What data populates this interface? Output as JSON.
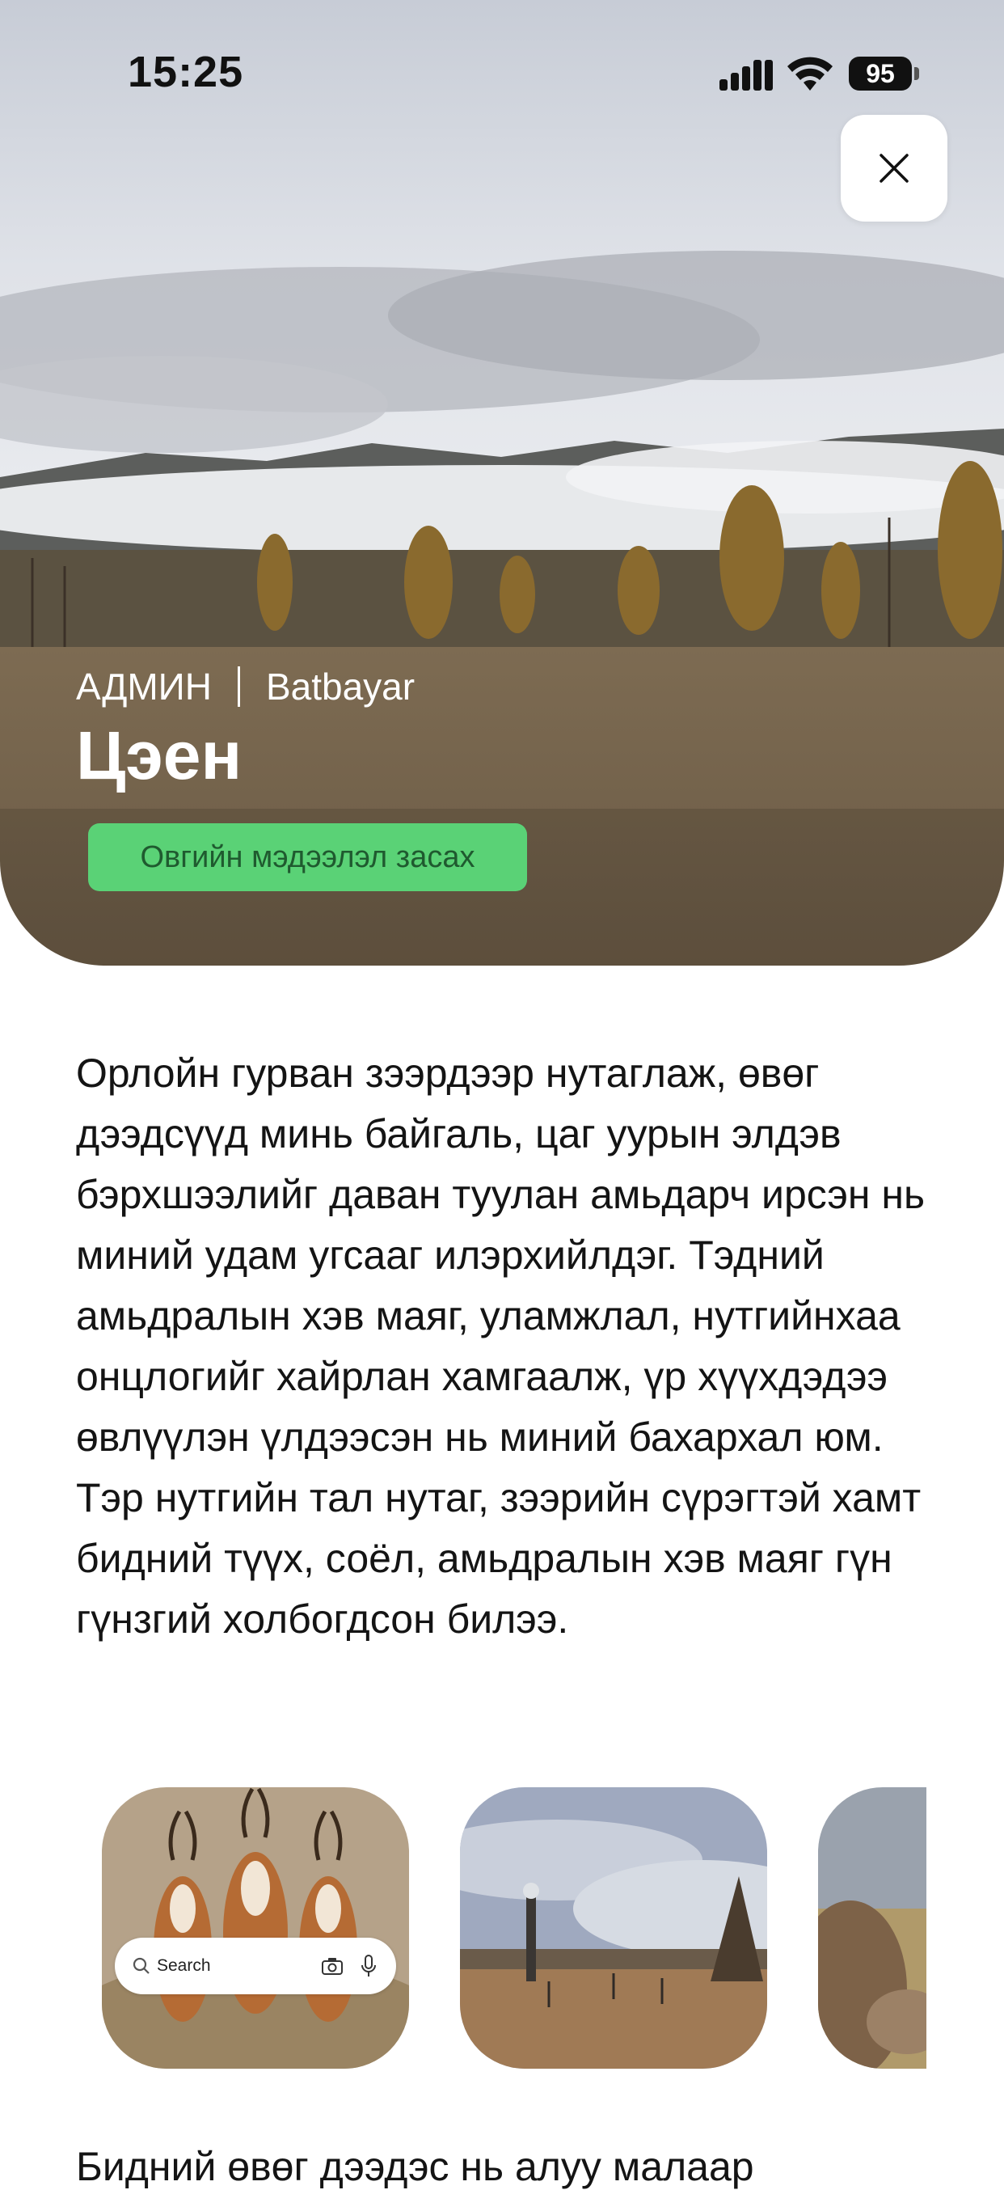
{
  "status_bar": {
    "time": "15:25",
    "battery": "95"
  },
  "hero": {
    "role": "АДМИН",
    "author": "Batbayar",
    "title": "Цэен",
    "edit_button_label": "Овгийн мэдээлэл засах"
  },
  "story": {
    "paragraph": "Орлойн гурван зээрдээр нутаглаж, өвөг дээдсүүд минь байгаль, цаг уурын элдэв бэрхшээлийг даван туулан амьдарч ирсэн нь миний удам угсааг илэрхийлдэг. Тэдний амьдралын хэв маяг, уламжлал, нутгийнхаа онцлогийг хайрлан хамгаалж, үр хүүхдэдээ өвлүүлэн үлдээсэн нь миний бахархал юм. Тэр нутгийн тал нутаг, зээрийн сүрэгтэй хамт бидний түүх, соёл, амьдралын хэв маяг гүн гүнзгий холбогдсон билээ.",
    "continued": "Бидний өвөг дээдэс нь алуу малаар"
  },
  "gallery": {
    "search_placeholder": "Search"
  },
  "colors": {
    "accent_green": "#5ad276",
    "accent_green_text": "#1f5a2f"
  },
  "icons": [
    "signal-icon",
    "wifi-icon",
    "battery-icon",
    "close-icon",
    "search-icon",
    "camera-icon",
    "microphone-icon"
  ]
}
